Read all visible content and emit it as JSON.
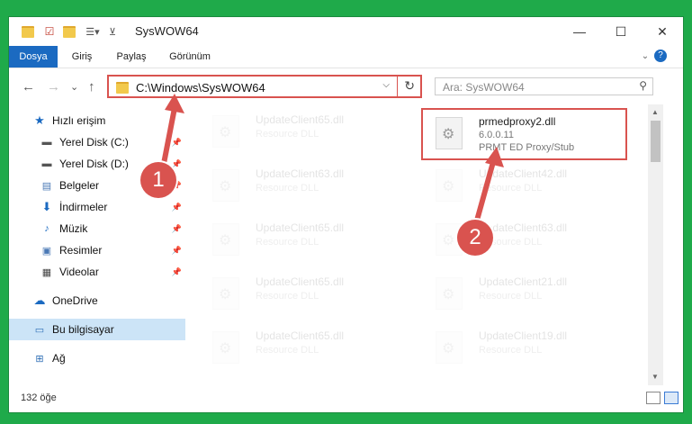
{
  "window": {
    "title": "SysWOW64",
    "controls": [
      "—",
      "☐",
      "✕"
    ]
  },
  "ribbon": {
    "tabs": [
      "Dosya",
      "Giriş",
      "Paylaş",
      "Görünüm"
    ],
    "help": "?"
  },
  "nav": {
    "back": "←",
    "forward": "→",
    "recent": "⌄",
    "up": "↑",
    "address": "C:\\Windows\\SysWOW64",
    "search_placeholder": "Ara: SysWOW64"
  },
  "sidebar": {
    "items": [
      {
        "label": "Hızlı erişim",
        "icon": "star-icon"
      },
      {
        "label": "Yerel Disk (C:)",
        "icon": "drive-icon"
      },
      {
        "label": "Yerel Disk (D:)",
        "icon": "drive-icon"
      },
      {
        "label": "Belgeler",
        "icon": "documents-icon"
      },
      {
        "label": "İndirmeler",
        "icon": "download-icon"
      },
      {
        "label": "Müzik",
        "icon": "music-icon"
      },
      {
        "label": "Resimler",
        "icon": "pictures-icon"
      },
      {
        "label": "Videolar",
        "icon": "video-icon"
      },
      {
        "label": "OneDrive",
        "icon": "cloud-icon"
      },
      {
        "label": "Bu bilgisayar",
        "icon": "computer-icon"
      },
      {
        "label": "Ağ",
        "icon": "network-icon"
      }
    ]
  },
  "files": {
    "left": [
      {
        "name": "UpdateClient65.dll",
        "type": "Resource DLL"
      },
      {
        "name": "UpdateClient63.dll",
        "type": "Resource DLL"
      },
      {
        "name": "UpdateClient65.dll",
        "type": "Resource DLL"
      },
      {
        "name": "UpdateClient65.dll",
        "type": "Resource DLL"
      },
      {
        "name": "UpdateClient65.dll",
        "type": "Resource DLL"
      }
    ],
    "highlighted": {
      "name": "prmedproxy2.dll",
      "version": "6.0.0.11",
      "description": "PRMT ED Proxy/Stub"
    },
    "right": [
      {
        "name": "UpdateClient42.dll",
        "type": "Resource DLL"
      },
      {
        "name": "UpdateClient63.dll",
        "type": "Resource DLL"
      },
      {
        "name": "UpdateClient21.dll",
        "type": "Resource DLL"
      },
      {
        "name": "UpdateClient19.dll",
        "type": "Resource DLL"
      }
    ]
  },
  "status": {
    "count": "132 öğe"
  },
  "annotations": {
    "badge1": "1",
    "badge2": "2"
  },
  "colors": {
    "accent": "#1b6ac1",
    "highlight": "#d9534f",
    "background": "#1faa4a"
  }
}
